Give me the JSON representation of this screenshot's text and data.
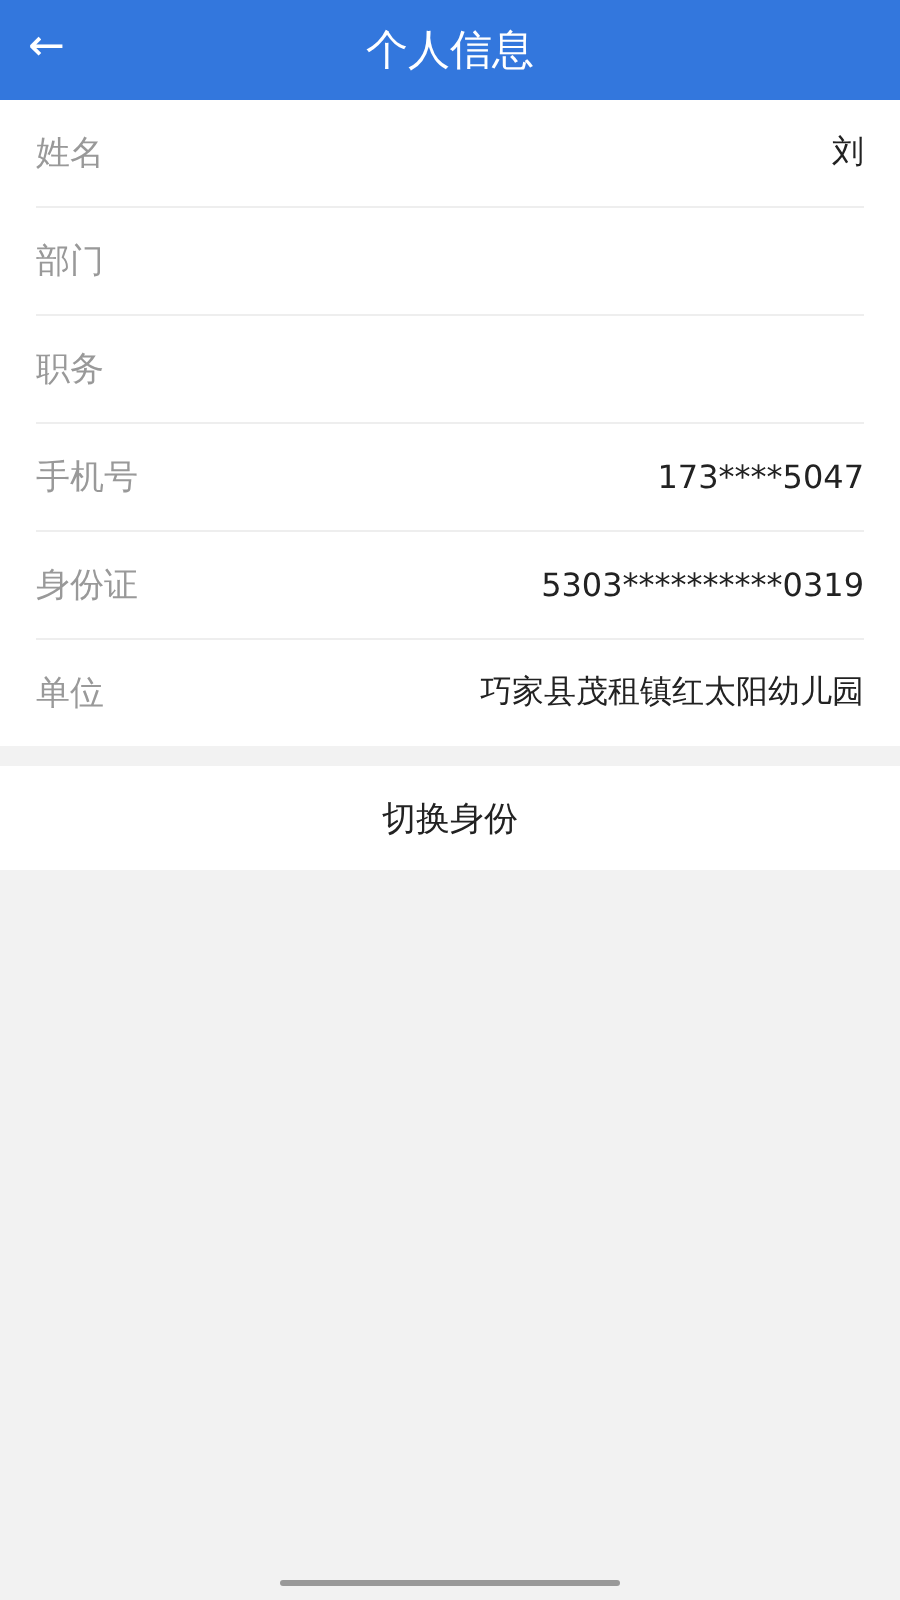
{
  "header": {
    "back": "←",
    "title": "个人信息"
  },
  "fields": [
    {
      "label": "姓名",
      "value": "刘"
    },
    {
      "label": "部门"
    },
    {
      "label": "职务"
    },
    {
      "label": "手机号",
      "value": "173****5047"
    },
    {
      "label": "身份证",
      "value": "5303**********0319"
    },
    {
      "label": "单位",
      "value": "巧家县茂租镇红太阳幼儿园"
    }
  ],
  "switch_button": "切换身份"
}
